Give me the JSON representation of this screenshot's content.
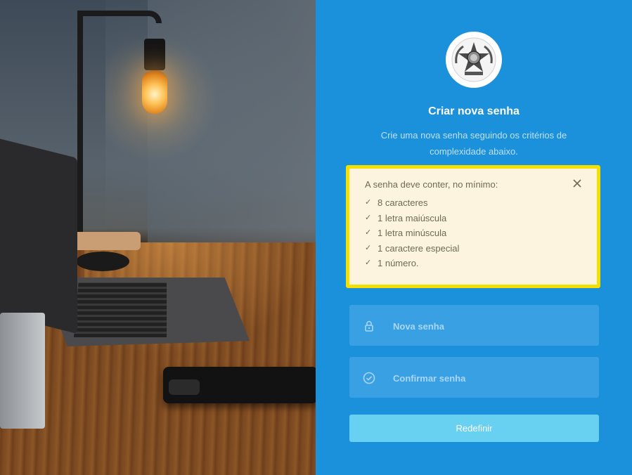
{
  "form": {
    "title": "Criar nova senha",
    "subtitle": "Crie uma nova senha seguindo os critérios de complexidade abaixo.",
    "alert": {
      "title": "A senha deve conter, no mínimo:",
      "requirements": [
        "8 caracteres",
        "1 letra maiúscula",
        "1 letra minúscula",
        "1 caractere especial",
        "1 número."
      ],
      "close_icon": "close-icon",
      "check_icon": "check-icon"
    },
    "new_password": {
      "placeholder": "Nova senha",
      "value": "",
      "icon": "lock-icon"
    },
    "confirm_password": {
      "placeholder": "Confirmar senha",
      "value": "",
      "icon": "check-circle-icon"
    },
    "submit_label": "Redefinir"
  },
  "colors": {
    "panel_bg": "#1b91dc",
    "field_bg": "#3aa0e4",
    "button_bg": "#68d0f0",
    "alert_bg": "#fcf4df",
    "alert_border": "#f5df00"
  },
  "logo": {
    "icon": "coat-of-arms-logo"
  }
}
